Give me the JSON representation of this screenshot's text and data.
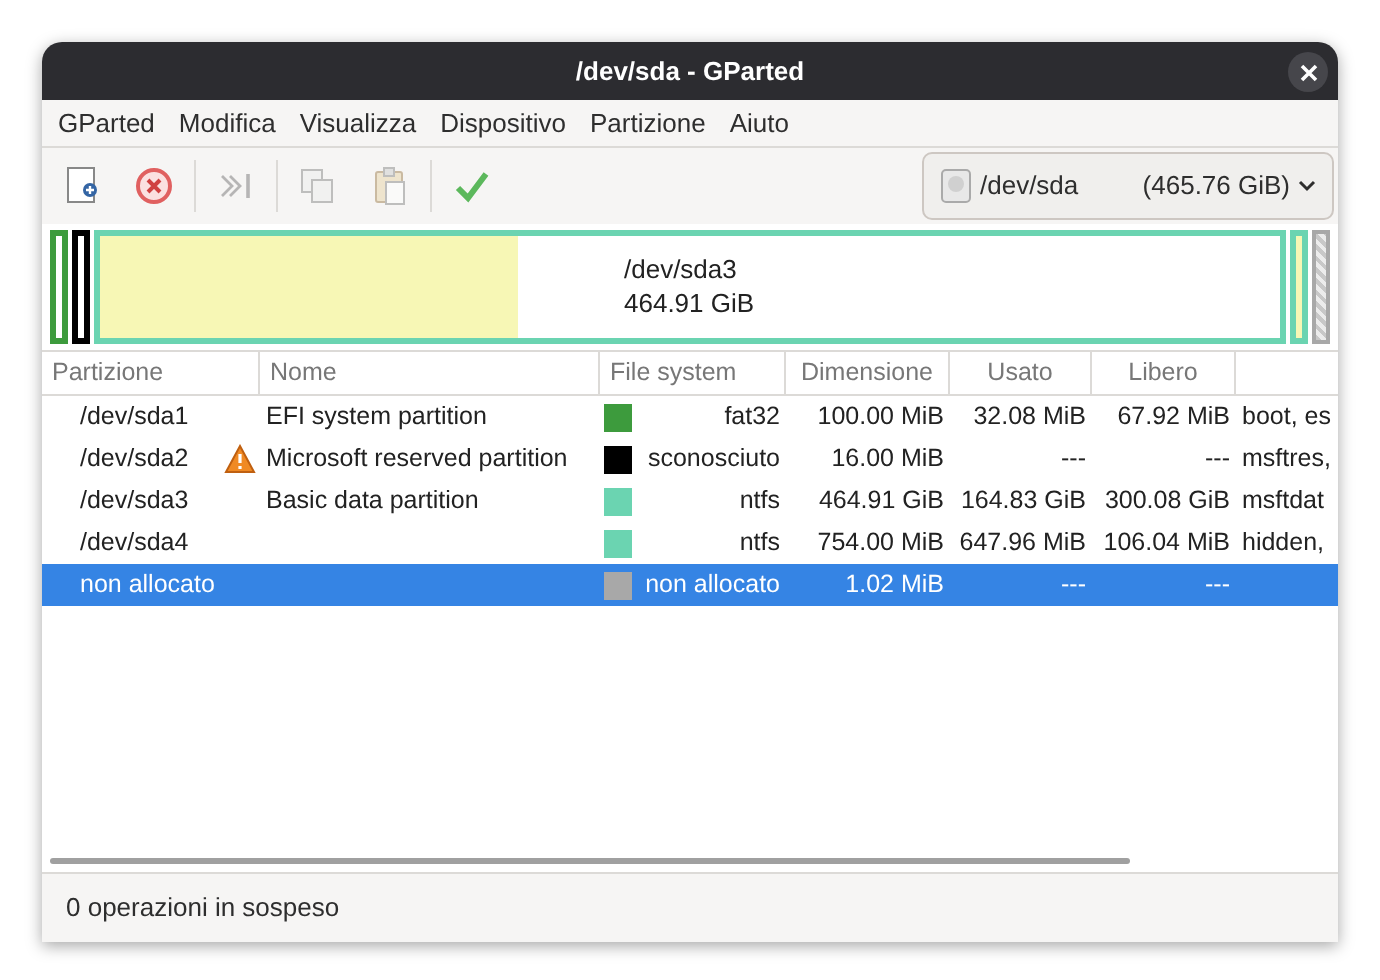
{
  "window": {
    "title": "/dev/sda - GParted"
  },
  "menu": [
    "GParted",
    "Modifica",
    "Visualizza",
    "Dispositivo",
    "Partizione",
    "Aiuto"
  ],
  "toolbar": [
    {
      "kind": "new",
      "disabled": false
    },
    {
      "kind": "delete",
      "disabled": false
    },
    {
      "kind": "resize",
      "disabled": true
    },
    {
      "kind": "copy",
      "disabled": true
    },
    {
      "kind": "paste",
      "disabled": true
    },
    {
      "kind": "apply",
      "disabled": false
    }
  ],
  "device": {
    "name": "/dev/sda",
    "size": "(465.76 GiB)"
  },
  "disk_map": [
    {
      "kind": "partition",
      "color": "#3d9b3d"
    },
    {
      "kind": "partition",
      "color": "#000000"
    },
    {
      "kind": "partition",
      "color": "#6bd4b1",
      "level": 0.355,
      "label": "/dev/sda3",
      "size": "464.91 GiB"
    },
    {
      "kind": "partition",
      "color": "#6bd4b1",
      "level": 0.86
    },
    {
      "kind": "unallocated",
      "color": "#a8a8a8"
    }
  ],
  "table": {
    "columns": [
      "Partizione",
      "Nome",
      "File system",
      "Dimensione",
      "Usato",
      "Libero"
    ],
    "rows": [
      {
        "partition": "/dev/sda1",
        "warning": false,
        "name": "EFI system partition",
        "color": "#3d9b3d",
        "filesystem": "fat32",
        "size": "100.00 MiB",
        "used": "32.08 MiB",
        "free": "67.92 MiB",
        "column_7": "boot, es",
        "selected": false
      },
      {
        "partition": "/dev/sda2",
        "warning": true,
        "name": "Microsoft reserved partition",
        "color": "#000000",
        "filesystem": "sconosciuto",
        "size": "16.00 MiB",
        "used": "---",
        "free": "---",
        "column_7": "msftres,",
        "selected": false
      },
      {
        "partition": "/dev/sda3",
        "warning": false,
        "name": "Basic data partition",
        "color": "#6bd4b1",
        "filesystem": "ntfs",
        "size": "464.91 GiB",
        "used": "164.83 GiB",
        "free": "300.08 GiB",
        "column_7": "msftdat",
        "selected": false
      },
      {
        "partition": "/dev/sda4",
        "warning": false,
        "name": "",
        "color": "#6bd4b1",
        "filesystem": "ntfs",
        "size": "754.00 MiB",
        "used": "647.96 MiB",
        "free": "106.04 MiB",
        "column_7": "hidden,",
        "selected": false
      },
      {
        "partition": "non allocato",
        "warning": false,
        "name": "",
        "color": "#a8a8a8",
        "filesystem": "non allocato",
        "size": "1.02 MiB",
        "used": "---",
        "free": "---",
        "column_7": "",
        "selected": true
      }
    ]
  },
  "status_bar": "0 operazioni in sospeso"
}
